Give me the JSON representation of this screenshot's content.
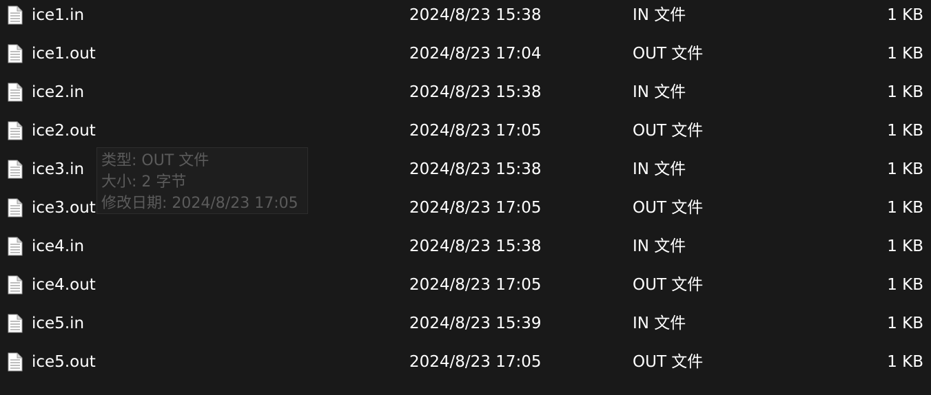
{
  "files": [
    {
      "name": "ice1.in",
      "date": "2024/8/23 15:38",
      "type": "IN 文件",
      "size": "1 KB",
      "icon": "document-icon"
    },
    {
      "name": "ice1.out",
      "date": "2024/8/23 17:04",
      "type": "OUT 文件",
      "size": "1 KB",
      "icon": "document-icon"
    },
    {
      "name": "ice2.in",
      "date": "2024/8/23 15:38",
      "type": "IN 文件",
      "size": "1 KB",
      "icon": "document-icon"
    },
    {
      "name": "ice2.out",
      "date": "2024/8/23 17:05",
      "type": "OUT 文件",
      "size": "1 KB",
      "icon": "document-icon"
    },
    {
      "name": "ice3.in",
      "date": "2024/8/23 15:38",
      "type": "IN 文件",
      "size": "1 KB",
      "icon": "document-icon"
    },
    {
      "name": "ice3.out",
      "date": "2024/8/23 17:05",
      "type": "OUT 文件",
      "size": "1 KB",
      "icon": "document-icon"
    },
    {
      "name": "ice4.in",
      "date": "2024/8/23 15:38",
      "type": "IN 文件",
      "size": "1 KB",
      "icon": "document-icon"
    },
    {
      "name": "ice4.out",
      "date": "2024/8/23 17:05",
      "type": "OUT 文件",
      "size": "1 KB",
      "icon": "document-icon"
    },
    {
      "name": "ice5.in",
      "date": "2024/8/23 15:39",
      "type": "IN 文件",
      "size": "1 KB",
      "icon": "document-icon"
    },
    {
      "name": "ice5.out",
      "date": "2024/8/23 17:05",
      "type": "OUT 文件",
      "size": "1 KB",
      "icon": "document-icon"
    }
  ],
  "tooltip": {
    "type_line": "类型: OUT 文件",
    "size_line": "大小: 2 字节",
    "modified_line": "修改日期: 2024/8/23 17:05"
  },
  "colors": {
    "background": "#191919",
    "text": "#ffffff",
    "tooltip_text": "#5b5b5b"
  }
}
